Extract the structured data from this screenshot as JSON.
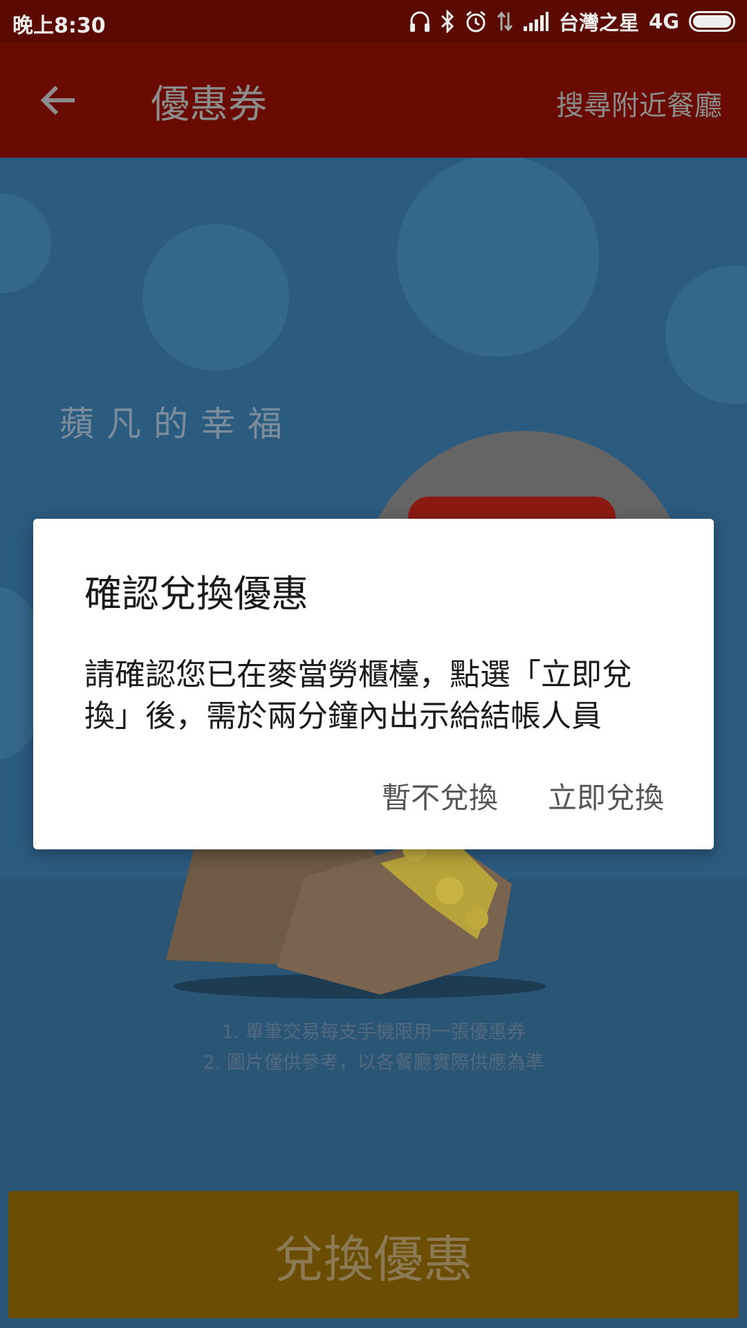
{
  "status_bar": {
    "time": "晚上8:30",
    "carrier": "台灣之星",
    "network": "4G",
    "icons": [
      "headset-icon",
      "bluetooth-icon",
      "alarm-icon",
      "data-arrows-icon",
      "signal-icon",
      "battery-icon"
    ]
  },
  "app_bar": {
    "back_icon": "arrow-left-icon",
    "title": "優惠券",
    "nearby_link": "搜尋附近餐廳"
  },
  "promo": {
    "subtitle": "蘋凡的幸福",
    "notes": [
      "1. 單筆交易每支手機限用一張優惠券",
      "2. 圖片僅供參考，以各餐廳實際供應為準"
    ]
  },
  "redeem_button": {
    "label": "兌換優惠"
  },
  "dialog": {
    "title": "確認兌換優惠",
    "message": "請確認您已在麥當勞櫃檯，點選「立即兌換」後，需於兩分鐘內出示給結帳人員",
    "cancel_label": "暫不兌換",
    "confirm_label": "立即兌換"
  },
  "colors": {
    "status_bar": "#5a0a00",
    "app_bar": "#6a0b02",
    "background": "#2c5b80",
    "redeem_button": "#6b4d04",
    "dialog_bg": "#ffffff"
  }
}
